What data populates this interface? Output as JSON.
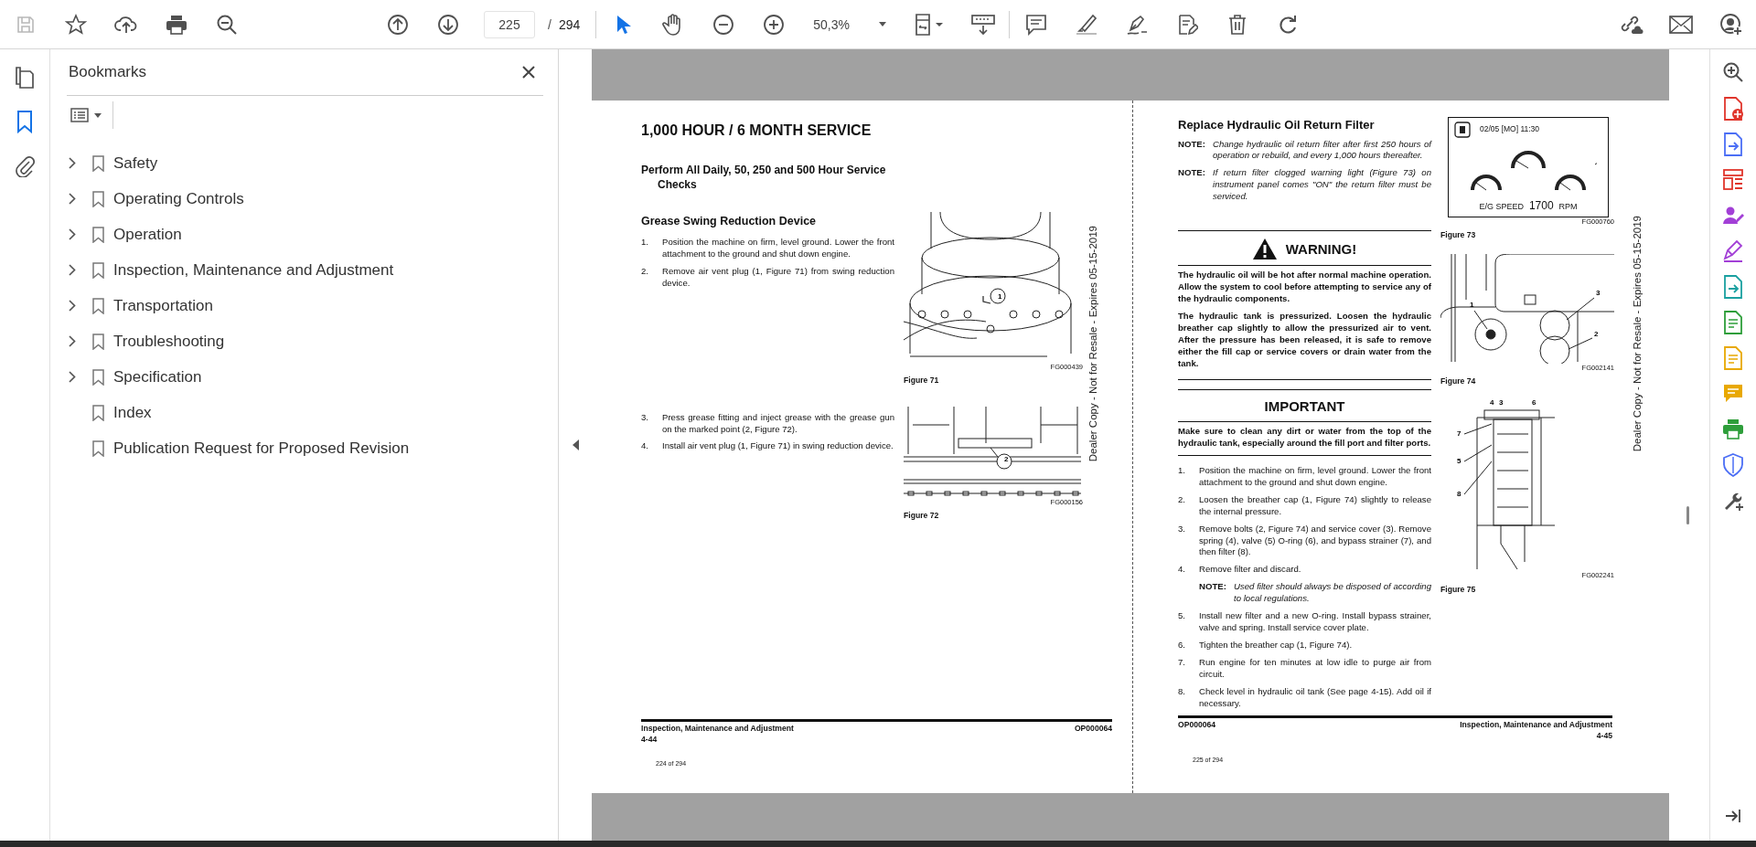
{
  "toolbar": {
    "save": {
      "disabled": true
    },
    "page": {
      "value": "225",
      "separator": "/",
      "total": "294"
    },
    "zoom": "50,3%",
    "pointer_tools": [
      {
        "kind": "select",
        "selected": true
      },
      {
        "kind": "hand",
        "selected": false
      }
    ]
  },
  "left_rail": [
    {
      "kind": "pages",
      "selected": false
    },
    {
      "kind": "bookmarks",
      "selected": true
    },
    {
      "kind": "attachments",
      "selected": false
    }
  ],
  "bookmarks": {
    "title": "Bookmarks",
    "items": [
      {
        "label": "Safety",
        "expandable": true
      },
      {
        "label": "Operating Controls",
        "expandable": true
      },
      {
        "label": "Operation",
        "expandable": true
      },
      {
        "label": "Inspection, Maintenance and Adjustment",
        "expandable": true
      },
      {
        "label": "Transportation",
        "expandable": true
      },
      {
        "label": "Troubleshooting",
        "expandable": true
      },
      {
        "label": "Specification",
        "expandable": true
      },
      {
        "label": "Index",
        "expandable": false
      },
      {
        "label": "Publication Request for Proposed Revision",
        "expandable": false
      }
    ]
  },
  "left_page": {
    "title": "1,000 HOUR / 6 MONTH SERVICE",
    "subtitle": "Perform All Daily, 50, 250 and 500 Hour Service Checks",
    "section": "Grease Swing Reduction Device",
    "steps_a": [
      {
        "number": "1.",
        "text": "Position the machine on firm, level ground. Lower the front attachment to the ground and shut down engine."
      },
      {
        "number": "2.",
        "text": "Remove air vent plug (1, Figure 71) from swing reduction device."
      }
    ],
    "steps_b": [
      {
        "number": "3.",
        "text": "Press grease fitting and inject grease with the grease gun on the marked point (2, Figure 72)."
      },
      {
        "number": "4.",
        "text": "Install air vent plug (1, Figure 71) in swing reduction device."
      }
    ],
    "figures": [
      {
        "kind": "swing_motor",
        "code": "FG000439",
        "caption": "Figure 71",
        "callouts": [
          "1"
        ]
      },
      {
        "kind": "track_frame",
        "code": "FG000156",
        "caption": "Figure 72",
        "callouts": [
          "2"
        ]
      }
    ],
    "stamp": "Dealer Copy - Not for Resale - Expires 05-15-2019",
    "footer": {
      "section": "Inspection, Maintenance and Adjustment",
      "page_number": "4-44",
      "code": "OP000064"
    },
    "page_count": "224 of 294"
  },
  "right_page": {
    "title": "Replace Hydraulic Oil Return Filter",
    "notes": [
      {
        "label": "NOTE:",
        "text": "Change hydraulic oil return filter after first 250 hours of operation or rebuild, and every 1,000 hours thereafter."
      },
      {
        "label": "NOTE:",
        "text": "If return filter clogged warning light (Figure 73) on instrument panel comes \"ON\" the return filter must be serviced."
      }
    ],
    "warning": {
      "title": "WARNING!",
      "paragraphs": [
        "The hydraulic oil will be hot after normal machine operation. Allow the system to cool before attempting to service any of the hydraulic components.",
        "The hydraulic tank is pressurized. Loosen the hydraulic breather cap slightly to allow the pressurized air to vent. After the pressure has been released, it is safe to remove either the fill cap or service covers or drain water from the tank."
      ]
    },
    "important": {
      "title": "IMPORTANT",
      "text": "Make sure to clean any dirt or water from the top of the hydraulic tank, especially around the fill port and filter ports."
    },
    "steps": [
      {
        "number": "1.",
        "text": "Position the machine on firm, level ground. Lower the front attachment to the ground and shut down engine."
      },
      {
        "number": "2.",
        "text": "Loosen the breather cap (1, Figure 74) slightly to release the internal pressure."
      },
      {
        "number": "3.",
        "text": "Remove bolts (2, Figure 74) and service cover (3). Remove spring (4), valve (5) O-ring (6), and bypass strainer (7), and then filter (8)."
      },
      {
        "number": "4.",
        "text": "Remove filter and discard.",
        "note": {
          "label": "NOTE:",
          "text": "Used filter should always be disposed of according to local regulations."
        }
      },
      {
        "number": "5.",
        "text": "Install new filter and a new O-ring. Install bypass strainer, valve and spring. Install service cover plate."
      },
      {
        "number": "6.",
        "text": "Tighten the breather cap (1, Figure 74)."
      },
      {
        "number": "7.",
        "text": "Run engine for ten minutes at low idle to purge air from circuit."
      },
      {
        "number": "8.",
        "text": "Check level in hydraulic oil tank (See page 4-15). Add oil if necessary."
      }
    ],
    "figures": [
      {
        "kind": "gauge_panel",
        "code": "FG000760",
        "caption": "Figure 73",
        "date": "02/05 [MO] 11:30",
        "speed_label": "E/G SPEED",
        "speed": "1700",
        "unit": "RPM"
      },
      {
        "kind": "tank_top",
        "code": "FG002141",
        "caption": "Figure 74",
        "callouts": [
          "1",
          "3",
          "2"
        ]
      },
      {
        "kind": "filter_section",
        "code": "FG002241",
        "caption": "Figure 75",
        "callouts": [
          "4",
          "3",
          "6",
          "7",
          "5",
          "8"
        ]
      }
    ],
    "stamp": "Dealer Copy - Not for Resale - Expires 05-15-2019",
    "footer": {
      "code": "OP000064",
      "section": "Inspection, Maintenance and Adjustment",
      "page_number": "4-45"
    },
    "page_count": "225 of 294"
  }
}
